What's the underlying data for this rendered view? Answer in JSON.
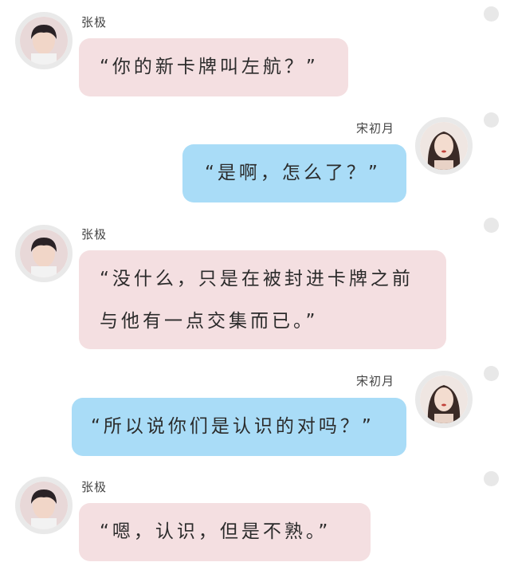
{
  "chat": {
    "messages": [
      {
        "sender": "张极",
        "side": "left",
        "text": "“你的新卡牌叫左航？”"
      },
      {
        "sender": "宋初月",
        "side": "right",
        "text": "“是啊，怎么了？”"
      },
      {
        "sender": "张极",
        "side": "left",
        "text": "“没什么，只是在被封进卡牌之前与他有一点交集而已。”"
      },
      {
        "sender": "宋初月",
        "side": "right",
        "text": "“所以说你们是认识的对吗？”"
      },
      {
        "sender": "张极",
        "side": "left",
        "text": "“嗯，认识，但是不熟。”"
      }
    ]
  },
  "colors": {
    "left_bubble": "#f4dfe1",
    "right_bubble": "#a9dcf7",
    "avatar_ring": "#e9e9e9",
    "select_dot": "#e8e8e8"
  }
}
